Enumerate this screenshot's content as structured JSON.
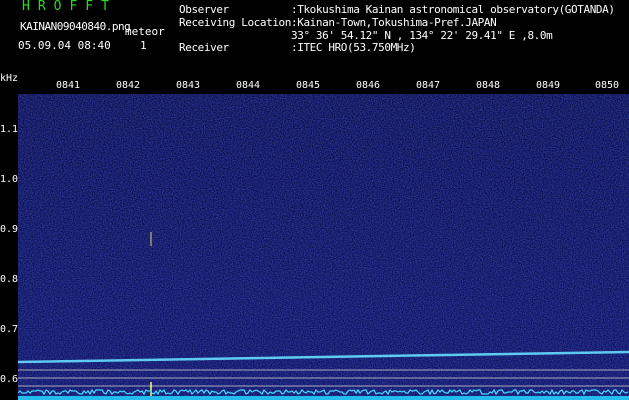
{
  "app": {
    "title": "HROFFT"
  },
  "file": {
    "name": "KAINAN09040840.png",
    "meteor_label": "meteor",
    "datetime": "05.09.04 08:40",
    "meteor_count": "1"
  },
  "info": {
    "observer": "Observer          :Tkokushima Kainan astronomical observatory(GOTANDA)",
    "location": "Receiving Location:Kainan-Town,Tokushima-Pref.JAPAN",
    "coords": "33° 36' 54.12\" N , 134° 22' 29.41\" E ,8.0m",
    "receiver": "Receiver          :ITEC HRO(53.750MHz)"
  },
  "axis": {
    "freq_unit": "kHz",
    "time_ticks": [
      "0841",
      "0842",
      "0843",
      "0844",
      "0845",
      "0846",
      "0847",
      "0848",
      "0849",
      "0850"
    ],
    "freq_ticks": [
      "1.1",
      "1.0",
      "0.9",
      "0.8",
      "0.7",
      "0.6"
    ]
  },
  "colors": {
    "background": "#000000",
    "title": "#22dd22",
    "spectrum": "#0a0c55",
    "carrier": "#66ddff",
    "text": "#ffffff"
  }
}
